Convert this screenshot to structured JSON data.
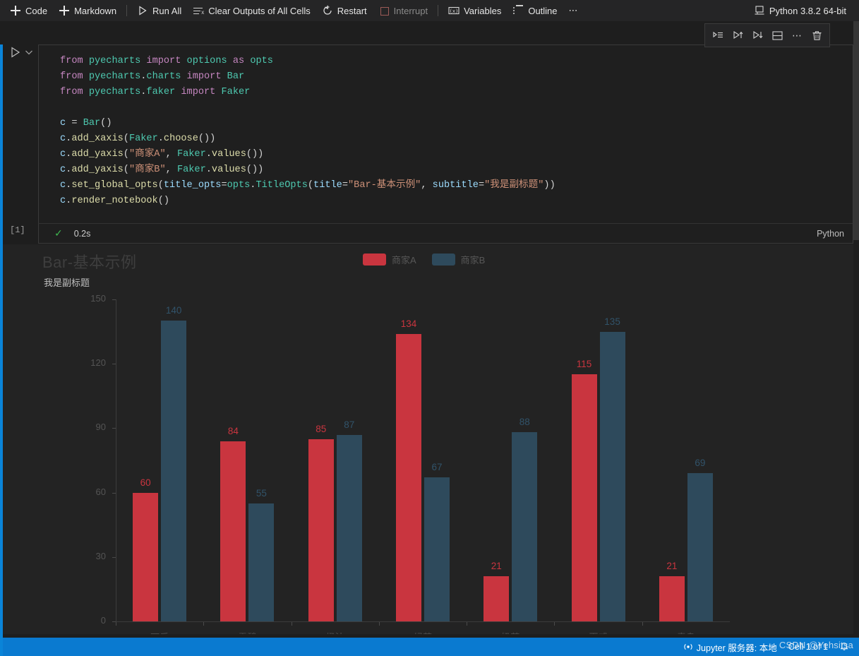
{
  "toolbar": {
    "add_code_label": "Code",
    "add_markdown_label": "Markdown",
    "run_all_label": "Run All",
    "clear_outputs_label": "Clear Outputs of All Cells",
    "restart_label": "Restart",
    "interrupt_label": "Interrupt",
    "variables_label": "Variables",
    "outline_label": "Outline",
    "more_label": "⋯",
    "kernel_label": "Python 3.8.2 64-bit"
  },
  "cell_toolbar": {
    "run_by_line_label": "Run by Line",
    "run_above_label": "Execute Above Cells",
    "run_below_label": "Execute Cell and Below",
    "split_label": "Split Cell",
    "more_label": "⋯",
    "delete_label": "Delete Cell"
  },
  "cell": {
    "execution_count": "[1]",
    "run_time": "0.2s",
    "status_check": "✓",
    "language": "Python",
    "collapse_ellipsis": "···",
    "code_lines": [
      "from pyecharts import options as opts",
      "from pyecharts.charts import Bar",
      "from pyecharts.faker import Faker",
      "",
      "c = Bar()",
      "c.add_xaxis(Faker.choose())",
      "c.add_yaxis(\"商家A\", Faker.values())",
      "c.add_yaxis(\"商家B\", Faker.values())",
      "c.set_global_opts(title_opts=opts.TitleOpts(title=\"Bar-基本示例\", subtitle=\"我是副标题\"))",
      "c.render_notebook()"
    ]
  },
  "statusbar": {
    "jupyter_server_label": "Jupyter 服务器: 本地",
    "cell_label": "Cell 1 of 1",
    "watermark": "CSDN @Yehsitsa",
    "bell_icon": "bell-icon"
  },
  "chart_data": {
    "type": "bar",
    "title": "Bar-基本示例",
    "subtitle": "我是副标题",
    "categories": [
      "可乐",
      "雪碧",
      "橙汁",
      "绿茶",
      "奶茶",
      "百威",
      "青岛"
    ],
    "series": [
      {
        "name": "商家A",
        "color": "#c9353f",
        "values": [
          60,
          84,
          85,
          134,
          21,
          115,
          21
        ]
      },
      {
        "name": "商家B",
        "color": "#2e4a5c",
        "values": [
          140,
          55,
          87,
          67,
          88,
          135,
          69
        ]
      }
    ],
    "ylabel": "",
    "xlabel": "",
    "ylim": [
      0,
      150
    ],
    "yticks": [
      0,
      30,
      60,
      90,
      120,
      150
    ],
    "grid": false,
    "legend_position": "top-center",
    "label_show": true
  }
}
